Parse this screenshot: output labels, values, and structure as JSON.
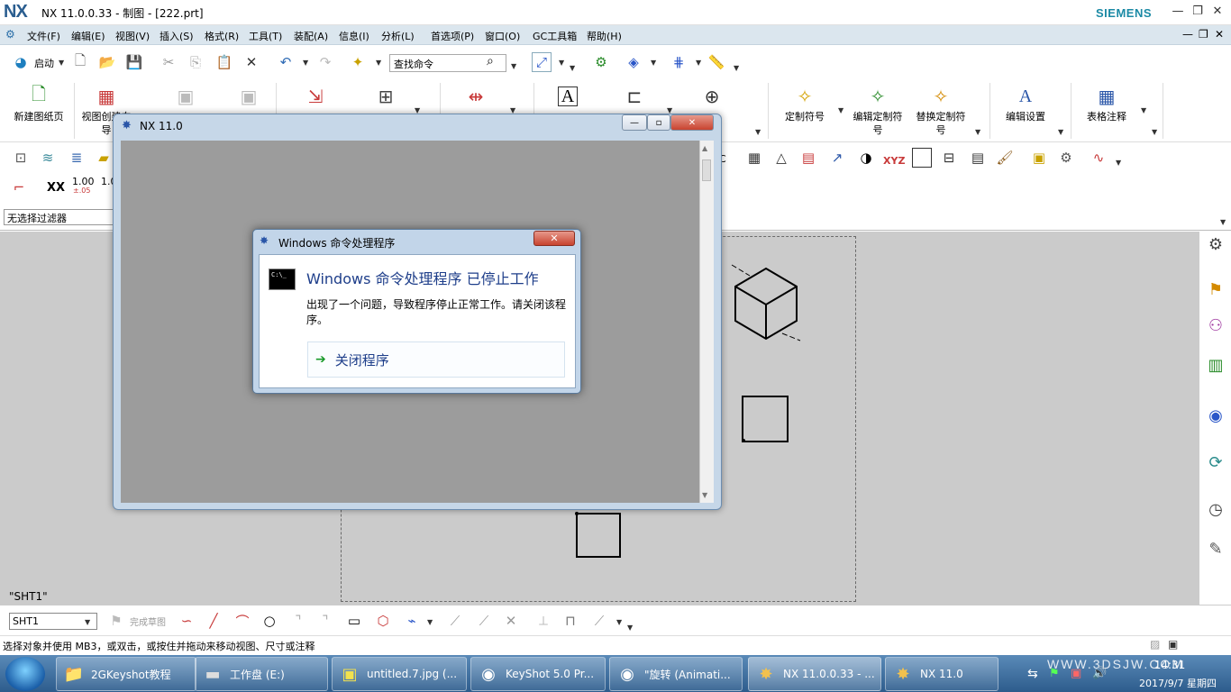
{
  "window": {
    "app_logo": "NX",
    "title": "NX 11.0.0.33 - 制图 - [222.prt]",
    "brand": "SIEMENS",
    "controls": [
      "—",
      "❐",
      "✕"
    ]
  },
  "menubar": {
    "items": [
      "文件(F)",
      "编辑(E)",
      "视图(V)",
      "插入(S)",
      "格式(R)",
      "工具(T)",
      "装配(A)",
      "信息(I)",
      "分析(L)",
      "首选项(P)",
      "窗口(O)",
      "GC工具箱",
      "帮助(H)"
    ]
  },
  "toolbar1": {
    "start_label": "启动",
    "search_placeholder": "查找命令"
  },
  "ribbon": {
    "groups": [
      {
        "label": "新建图纸页",
        "icon": "new-sheet-icon"
      },
      {
        "label": "视图创建向导",
        "icon": "view-wizard-icon"
      },
      {
        "label": "定制符号",
        "icon": "custom-symbol-icon"
      },
      {
        "label": "编辑定制符号",
        "icon": "edit-custom-symbol-icon"
      },
      {
        "label": "替换定制符号",
        "icon": "replace-custom-symbol-icon"
      },
      {
        "label": "编辑设置",
        "icon": "edit-settings-icon"
      },
      {
        "label": "表格注释",
        "icon": "table-note-icon"
      }
    ]
  },
  "toolbar4": {
    "dim_xx": "XX",
    "tol_1": "1.00",
    "tol_1_sub": "±.05",
    "tol_2": "1.0"
  },
  "filter": {
    "value": "无选择过滤器"
  },
  "canvas": {
    "sheet_label": "\"SHT1\""
  },
  "bottom_toolbar": {
    "sheet_select": "SHT1",
    "finish_sketch": "完成草图"
  },
  "status": {
    "text": "选择对象并使用 MB3，或双击，或按住并拖动来移动视图、尺寸或注释"
  },
  "nx_dialog": {
    "title": "NX 11.0"
  },
  "error_dialog": {
    "title": "Windows 命令处理程序",
    "heading": "Windows 命令处理程序 已停止工作",
    "message": "出现了一个问题，导致程序停止正常工作。请关闭该程序。",
    "action": "关闭程序",
    "close": "✕"
  },
  "taskbar": {
    "tasks": [
      {
        "label": "2GKeyshot教程",
        "icon": "folder-icon"
      },
      {
        "label": "工作盘 (E:)",
        "icon": "drive-icon"
      },
      {
        "label": "untitled.7.jpg (...",
        "icon": "image-icon"
      },
      {
        "label": "KeyShot 5.0 Pr...",
        "icon": "keyshot-icon"
      },
      {
        "label": "\"旋转 (Animati...",
        "icon": "keyshot-icon"
      },
      {
        "label": "NX 11.0.0.33 - ...",
        "icon": "nx-icon"
      },
      {
        "label": "NX 11.0",
        "icon": "nx-icon"
      }
    ],
    "watermark": "WWW.3DSJW.COM",
    "time": "14:31",
    "date": "2017/9/7 星期四"
  }
}
